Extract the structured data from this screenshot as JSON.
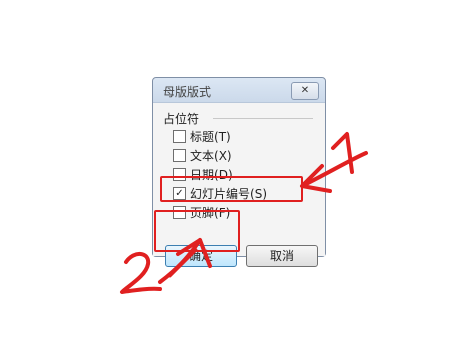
{
  "dialog": {
    "title": "母版版式",
    "close_glyph": "✕",
    "group_label": "占位符",
    "options": [
      {
        "label": "标题",
        "shortcut": "(T)",
        "checked": false
      },
      {
        "label": "文本",
        "shortcut": "(X)",
        "checked": false
      },
      {
        "label": "日期",
        "shortcut": "(D)",
        "checked": false
      },
      {
        "label": "幻灯片编号",
        "shortcut": "(S)",
        "checked": true
      },
      {
        "label": "页脚",
        "shortcut": "(F)",
        "checked": false
      }
    ],
    "ok_label": "确定",
    "cancel_label": "取消"
  },
  "annotations": {
    "color": "#e02020",
    "marks": [
      "1",
      "2"
    ]
  }
}
